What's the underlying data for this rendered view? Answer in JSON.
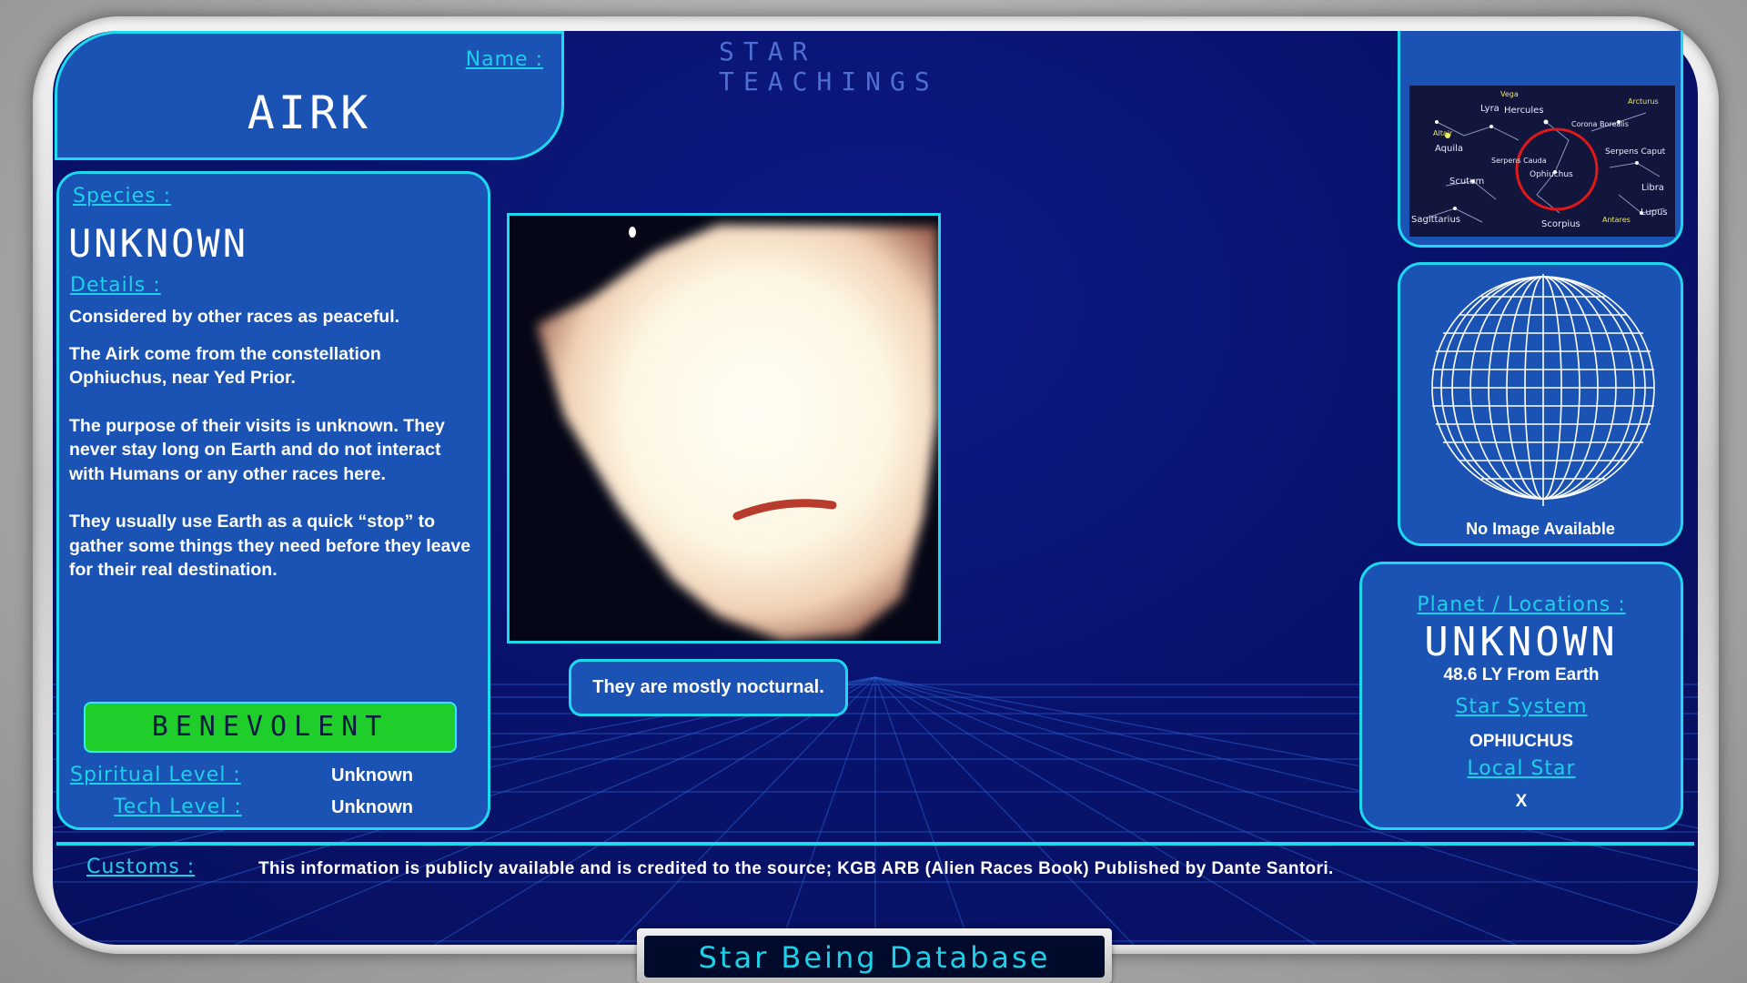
{
  "header": {
    "title": "STAR TEACHINGS"
  },
  "name_panel": {
    "label": "Name :",
    "value": "AIRK"
  },
  "species_panel": {
    "species_label": "Species :",
    "species_value": "UNKNOWN",
    "details_label": "Details :",
    "details": [
      "Considered by other races as peaceful.",
      "The Airk come from the constellation Ophiuchus, near Yed Prior.",
      "The purpose of their visits is unknown. They never stay long on Earth and do not interact with Humans or any other races here.",
      "They usually use Earth as a quick “stop” to gather some things they need before they leave for their real destination."
    ],
    "disposition": "BENEVOLENT",
    "spiritual_label": "Spiritual Level :",
    "spiritual_value": "Unknown",
    "tech_label": "Tech Level :",
    "tech_value": "Unknown"
  },
  "photo_caption": "They are mostly nocturnal.",
  "star_map": {
    "labels": [
      "Lyra",
      "Hercules",
      "Corona Borealis",
      "Arcturus",
      "Vega",
      "Ophiuchus",
      "Serpens Caput",
      "Serpens Cauda",
      "Aquila",
      "Scutum",
      "Libra",
      "Lupus",
      "Sagittarius",
      "Scorpius",
      "Antares",
      "Altair"
    ]
  },
  "globe_panel": {
    "caption": "No Image Available"
  },
  "location_panel": {
    "planet_label": "Planet / Locations :",
    "planet_value": "UNKNOWN",
    "distance": "48.6 LY From Earth",
    "system_label": "Star System",
    "system_value": "OPHIUCHUS",
    "local_star_label": "Local Star",
    "local_star_value": "X"
  },
  "footer": {
    "customs_label": "Customs :",
    "customs_text": "This information is publicly available and is credited to the source; KGB ARB (Alien Races Book) Published by Dante Santori."
  },
  "brand": {
    "title": "Star Being Database"
  },
  "colors": {
    "accent": "#1ed8ef",
    "panel": "#1a53b4",
    "benevolent": "#1fce2b",
    "background": "#08126a"
  }
}
